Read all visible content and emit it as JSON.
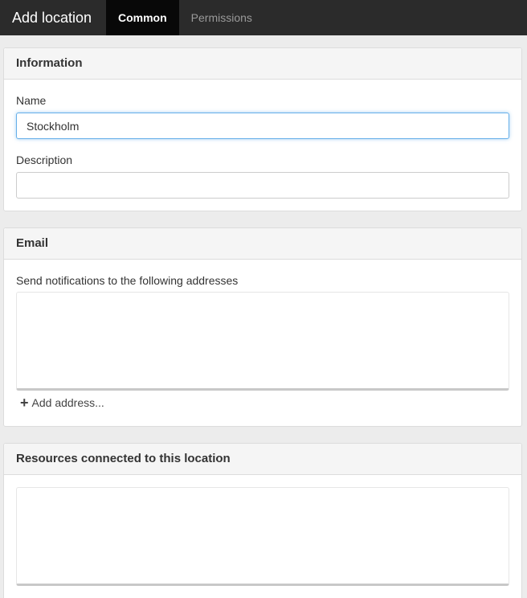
{
  "header": {
    "title": "Add location",
    "tabs": [
      {
        "label": "Common",
        "active": true
      },
      {
        "label": "Permissions",
        "active": false
      }
    ]
  },
  "information": {
    "heading": "Information",
    "name_label": "Name",
    "name_value": "Stockholm",
    "description_label": "Description",
    "description_value": ""
  },
  "email": {
    "heading": "Email",
    "notify_label": "Send notifications to the following addresses",
    "add_address_label": "Add address..."
  },
  "resources": {
    "heading": "Resources connected to this location"
  },
  "colors": {
    "topbar": "#2b2b2b",
    "active_tab": "#080808",
    "focus": "#66afe9"
  }
}
